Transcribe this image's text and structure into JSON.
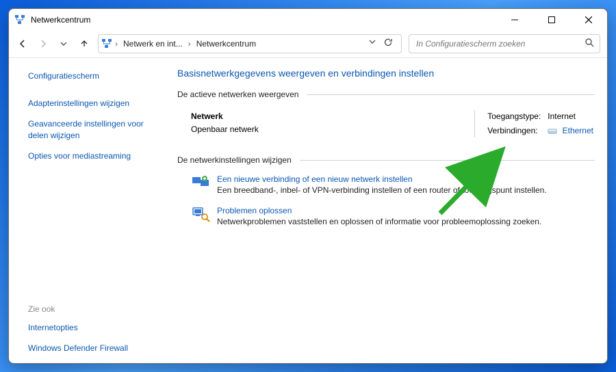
{
  "window": {
    "title": "Netwerkcentrum"
  },
  "toolbar": {
    "breadcrumb1": "Netwerk en int...",
    "breadcrumb2": "Netwerkcentrum",
    "search_placeholder": "In Configuratiescherm zoeken"
  },
  "sidebar": {
    "home": "Configuratiescherm",
    "links": [
      "Adapterinstellingen wijzigen",
      "Geavanceerde instellingen voor delen wijzigen",
      "Opties voor mediastreaming"
    ],
    "see_also_label": "Zie ook",
    "see_also": [
      "Internetopties",
      "Windows Defender Firewall"
    ]
  },
  "main": {
    "title": "Basisnetwerkgegevens weergeven en verbindingen instellen",
    "section_active": "De actieve netwerken weergeven",
    "network": {
      "name": "Netwerk",
      "profile": "Openbaar netwerk",
      "access_label": "Toegangstype:",
      "access_value": "Internet",
      "connections_label": "Verbindingen:",
      "connections_value": "Ethernet"
    },
    "section_change": "De netwerkinstellingen wijzigen",
    "task1": {
      "title": "Een nieuwe verbinding of een nieuw netwerk instellen",
      "desc": "Een breedband-, inbel- of VPN-verbinding instellen of een router of toegangspunt instellen."
    },
    "task2": {
      "title": "Problemen oplossen",
      "desc": "Netwerkproblemen vaststellen en oplossen of informatie voor probleemoplossing zoeken."
    }
  }
}
